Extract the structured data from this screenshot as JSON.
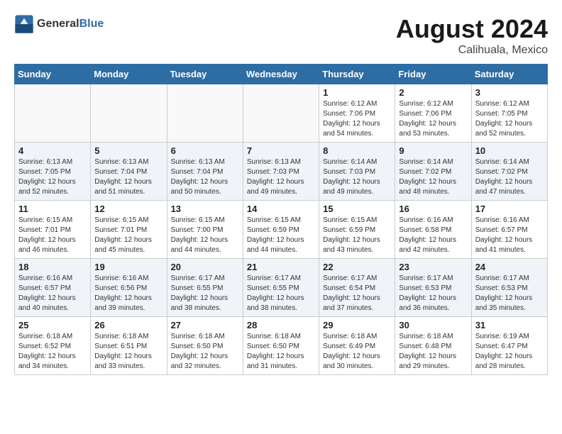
{
  "header": {
    "logo_general": "General",
    "logo_blue": "Blue",
    "month_year": "August 2024",
    "location": "Calihuala, Mexico"
  },
  "days_of_week": [
    "Sunday",
    "Monday",
    "Tuesday",
    "Wednesday",
    "Thursday",
    "Friday",
    "Saturday"
  ],
  "weeks": [
    [
      {
        "day": "",
        "info": ""
      },
      {
        "day": "",
        "info": ""
      },
      {
        "day": "",
        "info": ""
      },
      {
        "day": "",
        "info": ""
      },
      {
        "day": "1",
        "info": "Sunrise: 6:12 AM\nSunset: 7:06 PM\nDaylight: 12 hours\nand 54 minutes."
      },
      {
        "day": "2",
        "info": "Sunrise: 6:12 AM\nSunset: 7:06 PM\nDaylight: 12 hours\nand 53 minutes."
      },
      {
        "day": "3",
        "info": "Sunrise: 6:12 AM\nSunset: 7:05 PM\nDaylight: 12 hours\nand 52 minutes."
      }
    ],
    [
      {
        "day": "4",
        "info": "Sunrise: 6:13 AM\nSunset: 7:05 PM\nDaylight: 12 hours\nand 52 minutes."
      },
      {
        "day": "5",
        "info": "Sunrise: 6:13 AM\nSunset: 7:04 PM\nDaylight: 12 hours\nand 51 minutes."
      },
      {
        "day": "6",
        "info": "Sunrise: 6:13 AM\nSunset: 7:04 PM\nDaylight: 12 hours\nand 50 minutes."
      },
      {
        "day": "7",
        "info": "Sunrise: 6:13 AM\nSunset: 7:03 PM\nDaylight: 12 hours\nand 49 minutes."
      },
      {
        "day": "8",
        "info": "Sunrise: 6:14 AM\nSunset: 7:03 PM\nDaylight: 12 hours\nand 49 minutes."
      },
      {
        "day": "9",
        "info": "Sunrise: 6:14 AM\nSunset: 7:02 PM\nDaylight: 12 hours\nand 48 minutes."
      },
      {
        "day": "10",
        "info": "Sunrise: 6:14 AM\nSunset: 7:02 PM\nDaylight: 12 hours\nand 47 minutes."
      }
    ],
    [
      {
        "day": "11",
        "info": "Sunrise: 6:15 AM\nSunset: 7:01 PM\nDaylight: 12 hours\nand 46 minutes."
      },
      {
        "day": "12",
        "info": "Sunrise: 6:15 AM\nSunset: 7:01 PM\nDaylight: 12 hours\nand 45 minutes."
      },
      {
        "day": "13",
        "info": "Sunrise: 6:15 AM\nSunset: 7:00 PM\nDaylight: 12 hours\nand 44 minutes."
      },
      {
        "day": "14",
        "info": "Sunrise: 6:15 AM\nSunset: 6:59 PM\nDaylight: 12 hours\nand 44 minutes."
      },
      {
        "day": "15",
        "info": "Sunrise: 6:15 AM\nSunset: 6:59 PM\nDaylight: 12 hours\nand 43 minutes."
      },
      {
        "day": "16",
        "info": "Sunrise: 6:16 AM\nSunset: 6:58 PM\nDaylight: 12 hours\nand 42 minutes."
      },
      {
        "day": "17",
        "info": "Sunrise: 6:16 AM\nSunset: 6:57 PM\nDaylight: 12 hours\nand 41 minutes."
      }
    ],
    [
      {
        "day": "18",
        "info": "Sunrise: 6:16 AM\nSunset: 6:57 PM\nDaylight: 12 hours\nand 40 minutes."
      },
      {
        "day": "19",
        "info": "Sunrise: 6:16 AM\nSunset: 6:56 PM\nDaylight: 12 hours\nand 39 minutes."
      },
      {
        "day": "20",
        "info": "Sunrise: 6:17 AM\nSunset: 6:55 PM\nDaylight: 12 hours\nand 38 minutes."
      },
      {
        "day": "21",
        "info": "Sunrise: 6:17 AM\nSunset: 6:55 PM\nDaylight: 12 hours\nand 38 minutes."
      },
      {
        "day": "22",
        "info": "Sunrise: 6:17 AM\nSunset: 6:54 PM\nDaylight: 12 hours\nand 37 minutes."
      },
      {
        "day": "23",
        "info": "Sunrise: 6:17 AM\nSunset: 6:53 PM\nDaylight: 12 hours\nand 36 minutes."
      },
      {
        "day": "24",
        "info": "Sunrise: 6:17 AM\nSunset: 6:53 PM\nDaylight: 12 hours\nand 35 minutes."
      }
    ],
    [
      {
        "day": "25",
        "info": "Sunrise: 6:18 AM\nSunset: 6:52 PM\nDaylight: 12 hours\nand 34 minutes."
      },
      {
        "day": "26",
        "info": "Sunrise: 6:18 AM\nSunset: 6:51 PM\nDaylight: 12 hours\nand 33 minutes."
      },
      {
        "day": "27",
        "info": "Sunrise: 6:18 AM\nSunset: 6:50 PM\nDaylight: 12 hours\nand 32 minutes."
      },
      {
        "day": "28",
        "info": "Sunrise: 6:18 AM\nSunset: 6:50 PM\nDaylight: 12 hours\nand 31 minutes."
      },
      {
        "day": "29",
        "info": "Sunrise: 6:18 AM\nSunset: 6:49 PM\nDaylight: 12 hours\nand 30 minutes."
      },
      {
        "day": "30",
        "info": "Sunrise: 6:18 AM\nSunset: 6:48 PM\nDaylight: 12 hours\nand 29 minutes."
      },
      {
        "day": "31",
        "info": "Sunrise: 6:19 AM\nSunset: 6:47 PM\nDaylight: 12 hours\nand 28 minutes."
      }
    ]
  ]
}
